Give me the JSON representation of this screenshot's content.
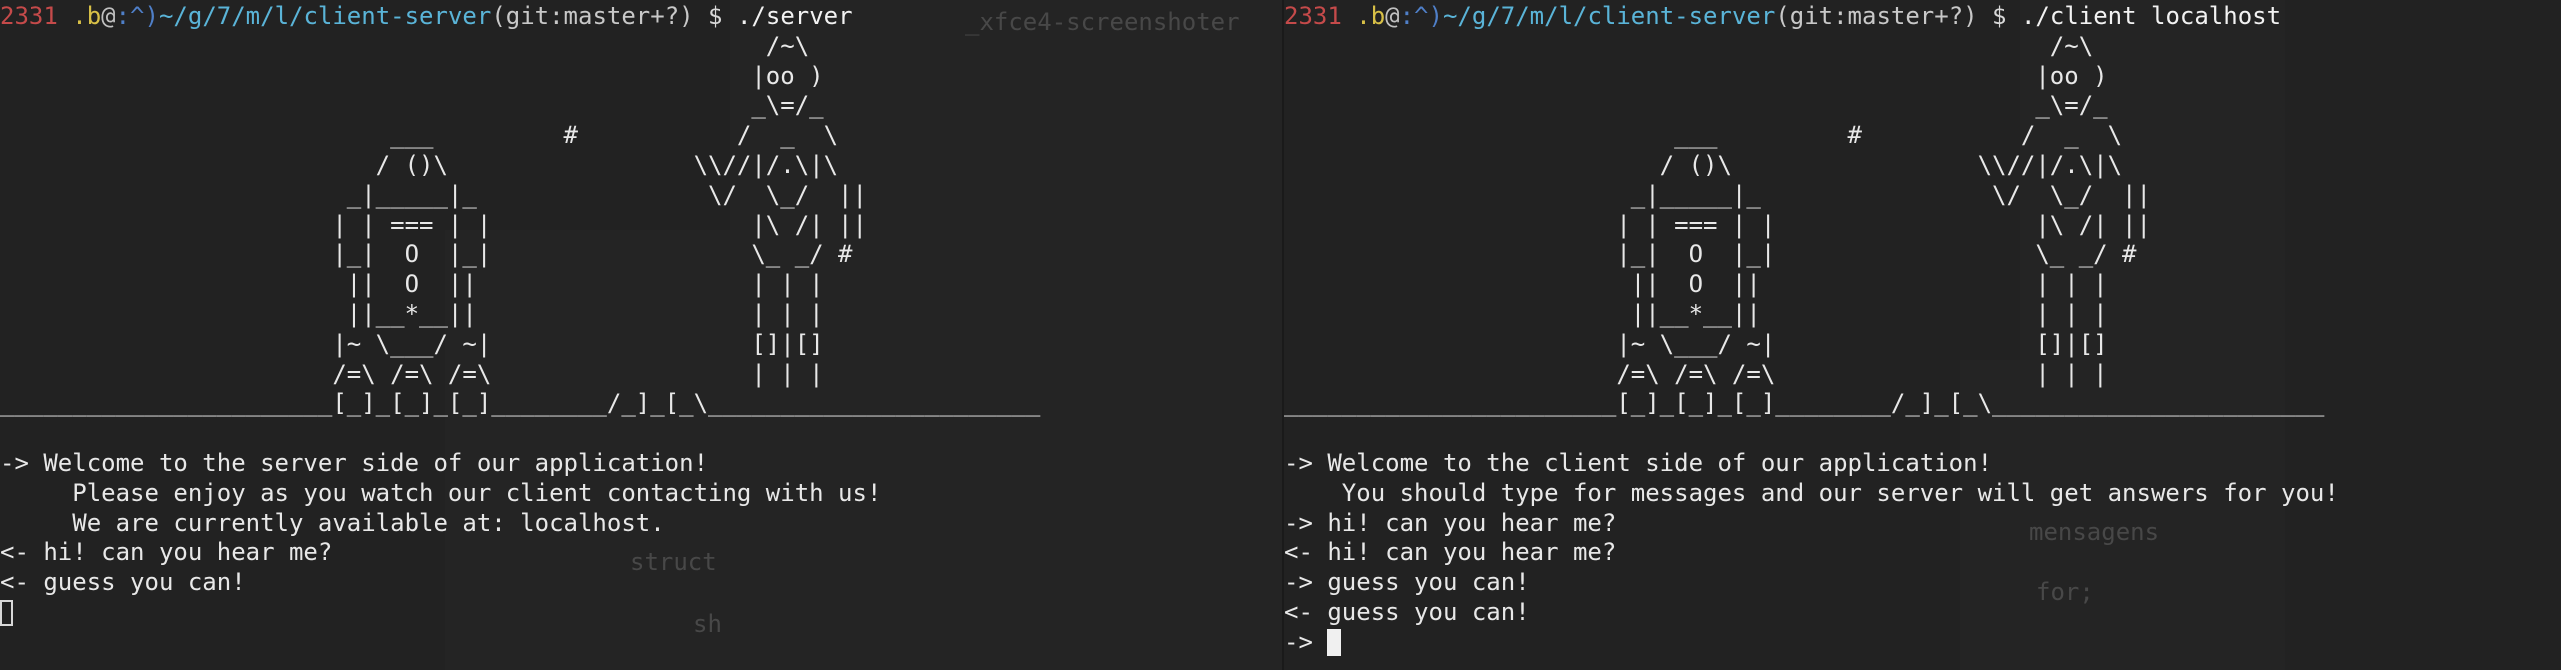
{
  "left_terminal": {
    "prompt": {
      "num": "2331",
      "user": " .b",
      "at": "@",
      "mode": ":^)",
      "path": "~/g/7/m/l/client-server",
      "git": "(git:master+?)",
      "dollar": " $ ",
      "command": "./server"
    },
    "ascii_art": "                                                     /~\\\n                                                    |oo )\n                                                    _\\=/_\n                           ___         #           /  _  \\\n                          / ()\\                 \\\\//|/.\\|\\\n                        _|_____|_                \\/  \\_/  ||\n                       | | === | |                  |\\ /| ||\n                       |_|  O  |_|                  \\_ _/ #\n                        ||  O  ||                   | | |\n                        ||__*__||                   | | |\n                       |~ \\___/ ~|                  []|[]\n                       /=\\ /=\\ /=\\                  | | |\n_______________________[_]_[_]_[_]________/_]_[_\\_______________________",
    "messages": [
      "-> Welcome to the server side of our application!",
      "     Please enjoy as you watch our client contacting with us!",
      "     We are currently available at: localhost.",
      "<- hi! can you hear me?",
      "<- guess you can!"
    ],
    "ghost_texts": [
      "_xfce4-screenshoter",
      "struct",
      "sh"
    ]
  },
  "right_terminal": {
    "prompt": {
      "num": "2331",
      "user": " .b",
      "at": "@",
      "mode": ":^)",
      "path": "~/g/7/m/l/client-server",
      "git": "(git:master+?)",
      "dollar": " $ ",
      "command": "./client localhost"
    },
    "ascii_art": "                                                     /~\\\n                                                    |oo )\n                                                    _\\=/_\n                           ___         #           /  _  \\\n                          / ()\\                 \\\\//|/.\\|\\\n                        _|_____|_                \\/  \\_/  ||\n                       | | === | |                  |\\ /| ||\n                       |_|  O  |_|                  \\_ _/ #\n                        ||  O  ||                   | | |\n                        ||__*__||                   | | |\n                       |~ \\___/ ~|                  []|[]\n                       /=\\ /=\\ /=\\                  | | |\n_______________________[_]_[_]_[_]________/_]_[_\\_______________________",
    "messages": [
      "-> Welcome to the client side of our application!",
      "    You should type for messages and our server will get answers for you!",
      "-> hi! can you hear me?",
      "<- hi! can you hear me?",
      "-> guess you can!",
      "<- guess you can!"
    ],
    "input_prompt": "-> ",
    "ghost_texts": [
      "mensagens",
      "for;"
    ]
  }
}
